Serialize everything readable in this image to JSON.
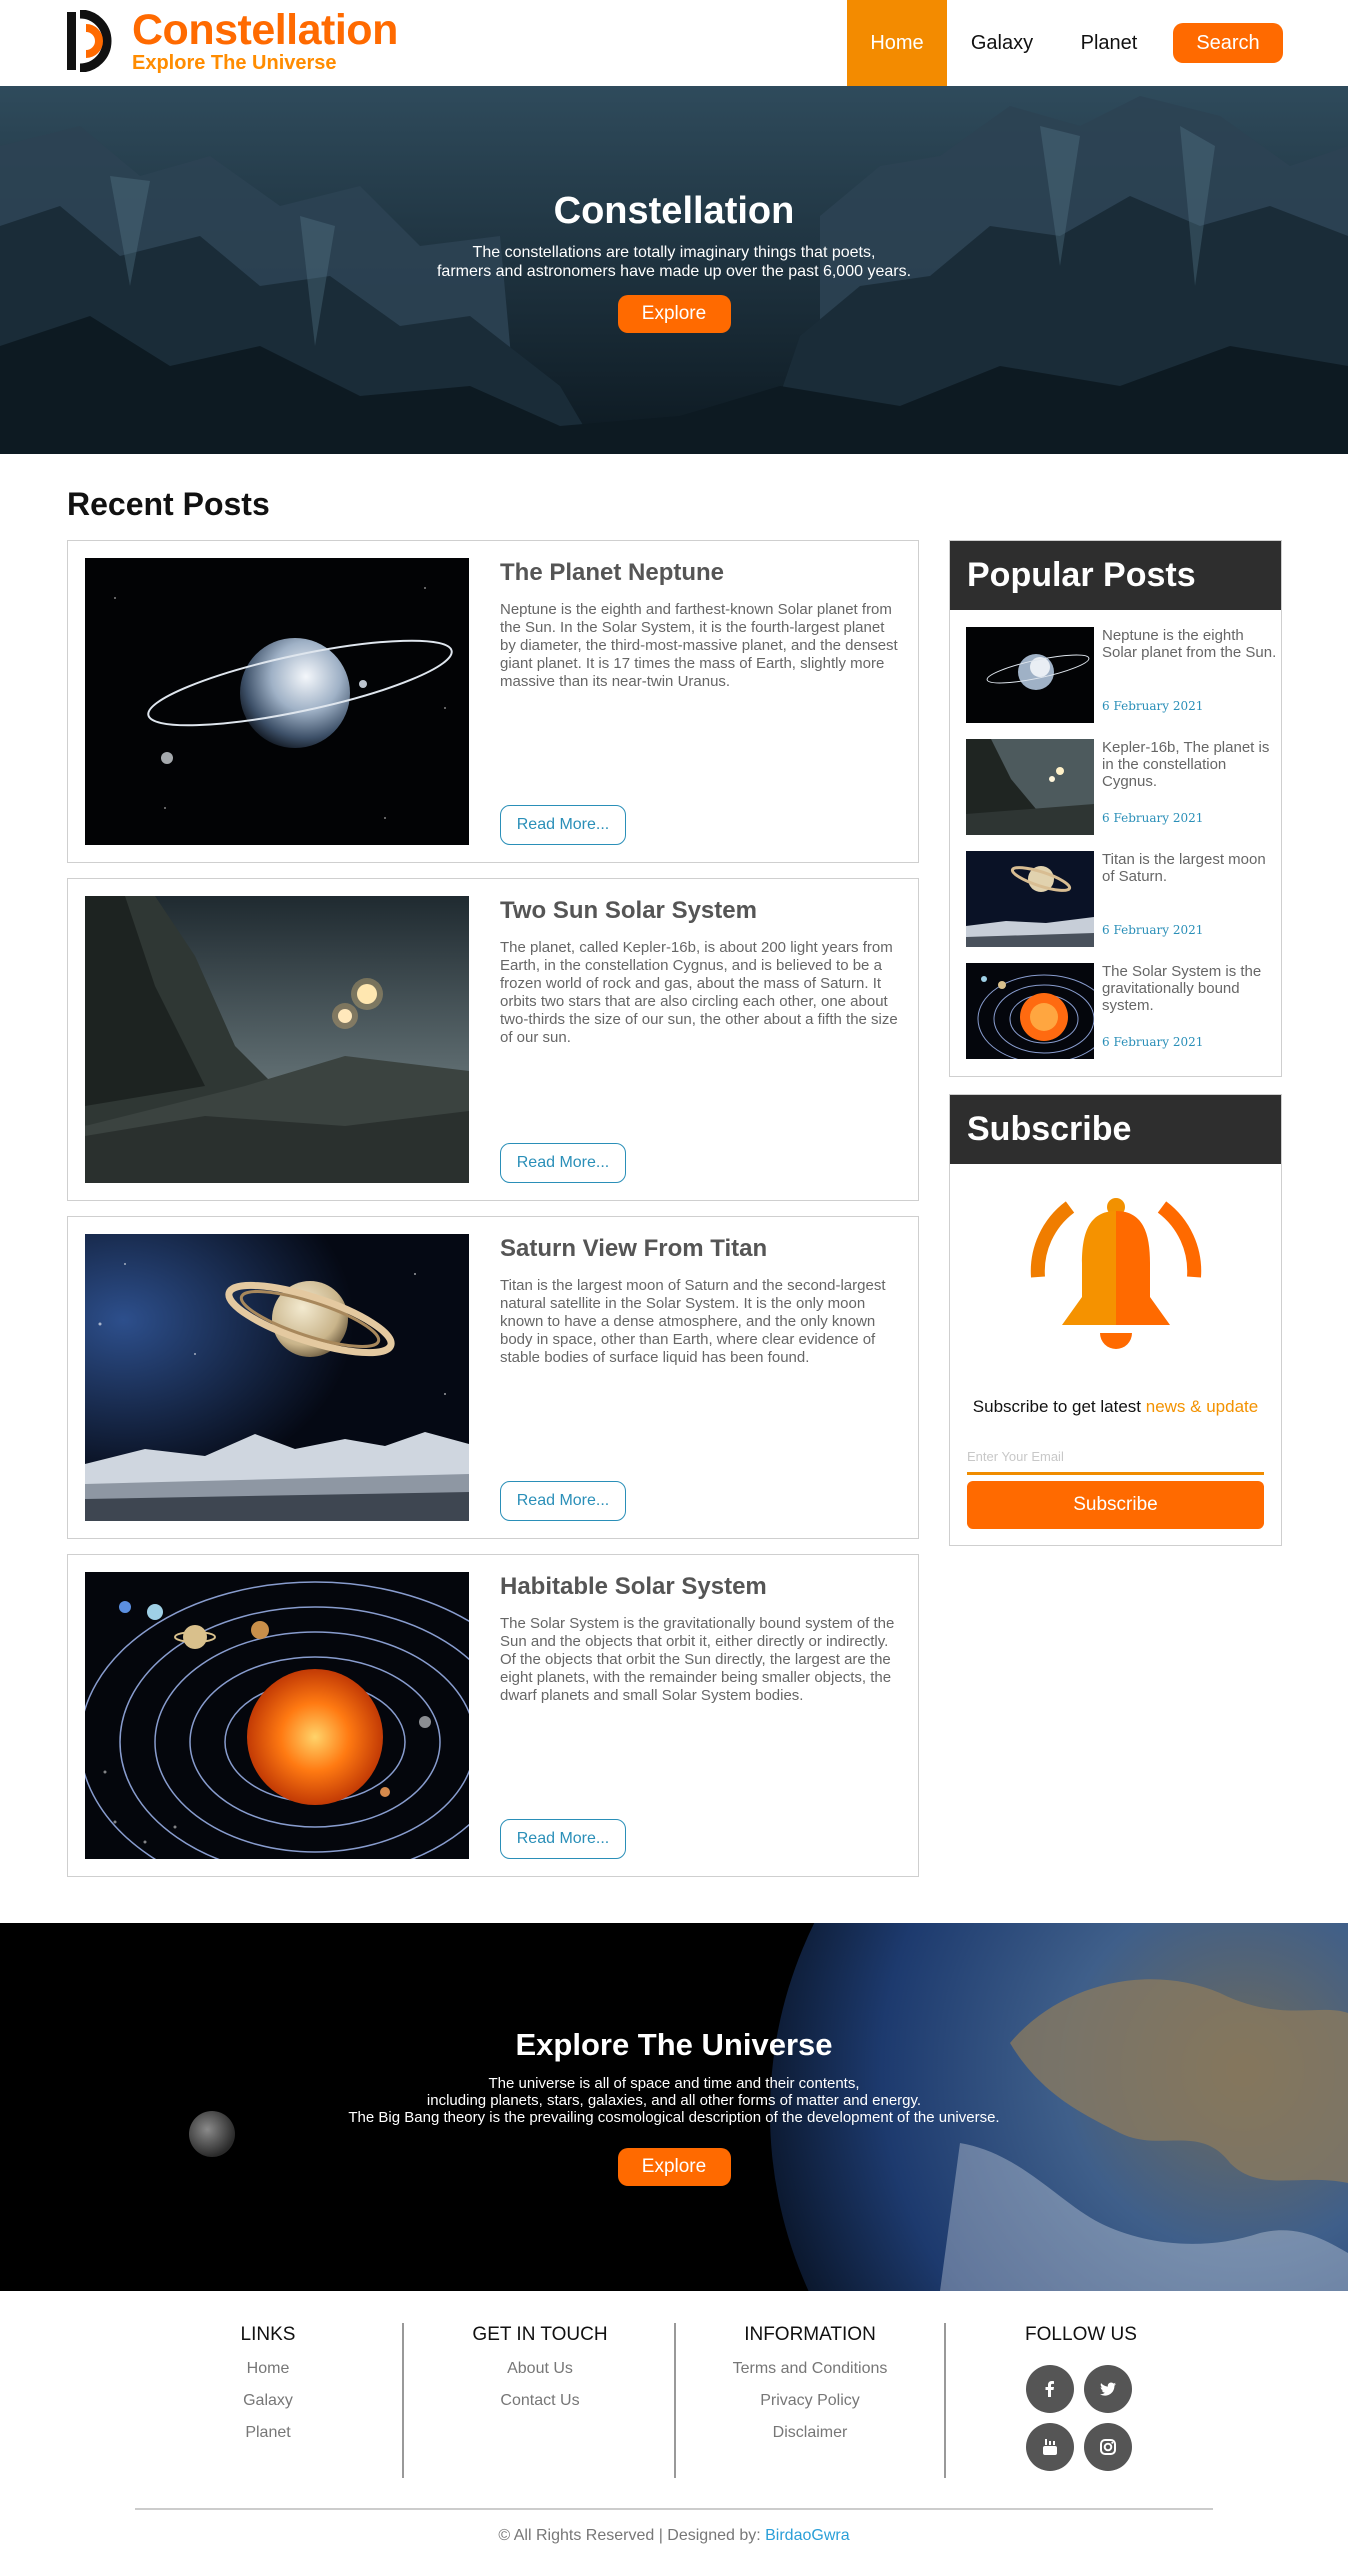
{
  "header": {
    "logo_title": "Constellation",
    "logo_tagline": "Explore The Universe",
    "nav": [
      {
        "label": "Home",
        "active": true
      },
      {
        "label": "Galaxy",
        "active": false
      },
      {
        "label": "Planet",
        "active": false
      }
    ],
    "search_label": "Search"
  },
  "hero": {
    "title": "Constellation",
    "text_line1": "The constellations are totally imaginary things that poets,",
    "text_line2": "farmers and astronomers have made up over the past 6,000 years.",
    "button": "Explore"
  },
  "recent": {
    "heading": "Recent Posts",
    "read_more": "Read More...",
    "posts": [
      {
        "title": "The Planet Neptune",
        "text": "Neptune is the eighth and farthest-known Solar planet from the Sun. In the Solar System, it is the fourth-largest planet by diameter, the third-most-massive planet, and the densest giant planet. It is 17 times the mass of Earth, slightly more massive than its near-twin Uranus."
      },
      {
        "title": "Two Sun Solar System",
        "text": "The planet, called Kepler-16b, is about 200 light years from Earth, in the constellation Cygnus, and is believed to be a frozen world of rock and gas, about the mass of Saturn. It orbits two stars that are also circling each other, one about two-thirds the size of our sun, the other about a fifth the size of our sun."
      },
      {
        "title": "Saturn View From Titan",
        "text": "Titan is the largest moon of Saturn and the second-largest natural satellite in the Solar System. It is the only moon known to have a dense atmosphere, and the only known body in space, other than Earth, where clear evidence of stable bodies of surface liquid has been found."
      },
      {
        "title": "Habitable Solar System",
        "text": "The Solar System is the gravitationally bound system of the Sun and the objects that orbit it, either directly or indirectly. Of the objects that orbit the Sun directly, the largest are the eight planets, with the remainder being smaller objects, the dwarf planets and small Solar System bodies."
      }
    ]
  },
  "popular": {
    "heading": "Popular Posts",
    "items": [
      {
        "text": "Neptune is the eighth Solar planet from the Sun.",
        "date": "6 February 2021"
      },
      {
        "text": "Kepler-16b, The planet is in the constellation Cygnus.",
        "date": "6 February 2021"
      },
      {
        "text": "Titan is the largest moon of Saturn.",
        "date": "6 February 2021"
      },
      {
        "text": "The Solar System is the gravitationally bound system.",
        "date": "6 February 2021"
      }
    ]
  },
  "subscribe": {
    "heading": "Subscribe",
    "line_plain": "Subscribe to get latest ",
    "line_accent": "news & update",
    "placeholder": "Enter Your Email",
    "button": "Subscribe"
  },
  "banner": {
    "title": "Explore The Universe",
    "line1": "The universe is all of space and time and their contents,",
    "line2": "including planets, stars, galaxies, and all other forms of matter and energy.",
    "line3": "The Big Bang theory is the prevailing cosmological description of the development of the universe.",
    "button": "Explore"
  },
  "footer": {
    "links": {
      "heading": "LINKS",
      "items": [
        "Home",
        "Galaxy",
        "Planet"
      ]
    },
    "contact": {
      "heading": "GET IN TOUCH",
      "items": [
        "About Us",
        "Contact Us"
      ]
    },
    "info": {
      "heading": "INFORMATION",
      "items": [
        "Terms and Conditions",
        "Privacy Policy",
        "Disclaimer"
      ]
    },
    "follow": {
      "heading": "FOLLOW US",
      "icons": [
        "facebook-icon",
        "twitter-icon",
        "youtube-icon",
        "instagram-icon"
      ]
    },
    "copyright": "© All Rights Reserved | Designed by: ",
    "designer": "BirdaoGwra"
  },
  "colors": {
    "accent": "#ff6a00",
    "nav_active": "#f38b00",
    "link_blue": "#2a8fb8",
    "dark_head": "#2e2e2e"
  }
}
